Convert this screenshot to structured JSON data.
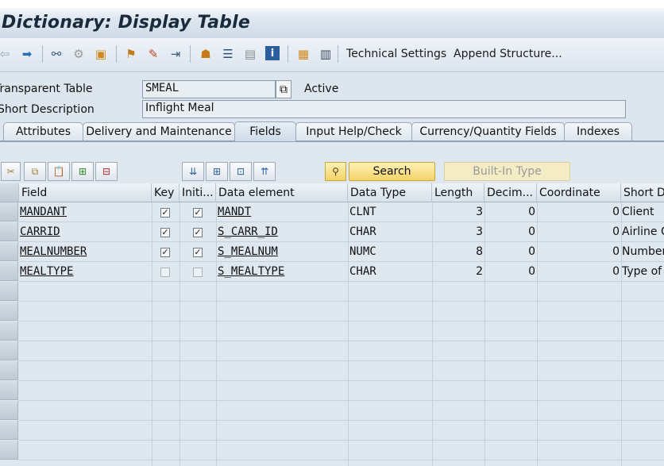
{
  "window": {
    "title": "Dictionary: Display Table"
  },
  "toolbar": {
    "icons": [
      "back-arrow-icon",
      "forward-arrow-icon",
      "glasses-icon",
      "display-change-icon",
      "check-icon",
      "activate-icon",
      "where-used-icon",
      "test-icon",
      "hierarchy-icon",
      "other-object-icon",
      "documentation-icon",
      "info-icon",
      "structure-icon",
      "table-icon"
    ],
    "technical_settings": "Technical Settings",
    "append_structure": "Append Structure..."
  },
  "header": {
    "table_label": "Transparent Table",
    "table_value": "SMEAL",
    "status": "Active",
    "desc_label": "Short Description",
    "desc_value": "Inflight Meal"
  },
  "tabs": [
    {
      "label": "Attributes"
    },
    {
      "label": "Delivery and Maintenance"
    },
    {
      "label": "Fields"
    },
    {
      "label": "Input Help/Check"
    },
    {
      "label": "Currency/Quantity Fields"
    },
    {
      "label": "Indexes"
    }
  ],
  "active_tab": "Fields",
  "fields_toolbar": {
    "search": "Search",
    "builtin_type": "Built-In Type"
  },
  "grid": {
    "columns": [
      "Field",
      "Key",
      "Initi...",
      "Data element",
      "Data Type",
      "Length",
      "Decim...",
      "Coordinate",
      "Short D"
    ],
    "rows": [
      {
        "field": "MANDANT",
        "key": true,
        "init": true,
        "element": "MANDT",
        "type": "CLNT",
        "length": "3",
        "dec": "0",
        "coord": "0",
        "short": "Client"
      },
      {
        "field": "CARRID",
        "key": true,
        "init": true,
        "element": "S_CARR_ID",
        "type": "CHAR",
        "length": "3",
        "dec": "0",
        "coord": "0",
        "short": "Airline Co"
      },
      {
        "field": "MEALNUMBER",
        "key": true,
        "init": true,
        "element": "S_MEALNUM",
        "type": "NUMC",
        "length": "8",
        "dec": "0",
        "coord": "0",
        "short": "Number"
      },
      {
        "field": "MEALTYPE",
        "key": false,
        "init": false,
        "element": "S_MEALTYPE",
        "type": "CHAR",
        "length": "2",
        "dec": "0",
        "coord": "0",
        "short": "Type of"
      }
    ]
  },
  "colors": {
    "accent": "#1a2a3a",
    "search_button": "#f3d365",
    "panel": "#dfe7ef"
  }
}
